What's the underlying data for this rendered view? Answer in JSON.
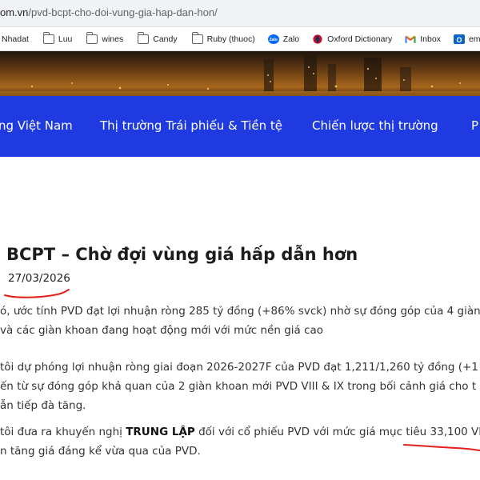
{
  "browser": {
    "url_domain": "om.vn",
    "url_path": "/pvd-bcpt-cho-doi-vung-gia-hap-dan-hon/",
    "bookmarks": [
      {
        "label": "Nhadat",
        "icon": "globe-icon"
      },
      {
        "label": "Luu",
        "icon": "folder-icon"
      },
      {
        "label": "wines",
        "icon": "folder-icon"
      },
      {
        "label": "Candy",
        "icon": "folder-icon"
      },
      {
        "label": "Ruby (thuoc)",
        "icon": "folder-icon"
      },
      {
        "label": "Zalo",
        "icon": "zalo-icon"
      },
      {
        "label": "Oxford Dictionary",
        "icon": "oxford-icon"
      },
      {
        "label": "Inbox",
        "icon": "gmail-icon"
      },
      {
        "label": "email tp",
        "icon": "outlook-icon"
      }
    ]
  },
  "nav": {
    "items": [
      {
        "label": "ng Việt Nam"
      },
      {
        "label": "Thị trường Trái phiếu & Tiền tệ"
      },
      {
        "label": "Chiến lược thị trường"
      },
      {
        "label": "P"
      }
    ]
  },
  "article": {
    "title": "BCPT – Chờ đợi vùng giá hấp dẫn hơn",
    "date": "27/03/2026",
    "paragraph1": [
      "ó, ước tính PVD đạt lợi nhuận ròng 285 tỷ đồng (+86% svck) nhờ sự đóng góp của 4 giàn",
      "và các giàn khoan đang hoạt động mới với mức nền giá cao"
    ],
    "paragraph2": [
      "tôi dự phóng lợi nhuận ròng giai đoạn 2026-2027F của PVD đạt 1,211/1,260 tỷ đồng (+1",
      "ến từ sự đóng góp khả quan của 2 giàn khoan mới PVD VIII & IX trong bối cảnh giá cho t",
      "ẫn tiếp đà tăng."
    ],
    "paragraph3": {
      "line1_before": "tôi đưa ra khuyến nghị ",
      "recommendation": "TRUNG LẬP",
      "line1_after": " đối với cổ phiếu PVD với mức giá mục tiêu 33,100 VN",
      "line2": "n tăng giá đáng kể vừa qua của PVD."
    }
  },
  "colors": {
    "nav_background": "#1e3ae0",
    "annotation_red": "#e0201a"
  }
}
